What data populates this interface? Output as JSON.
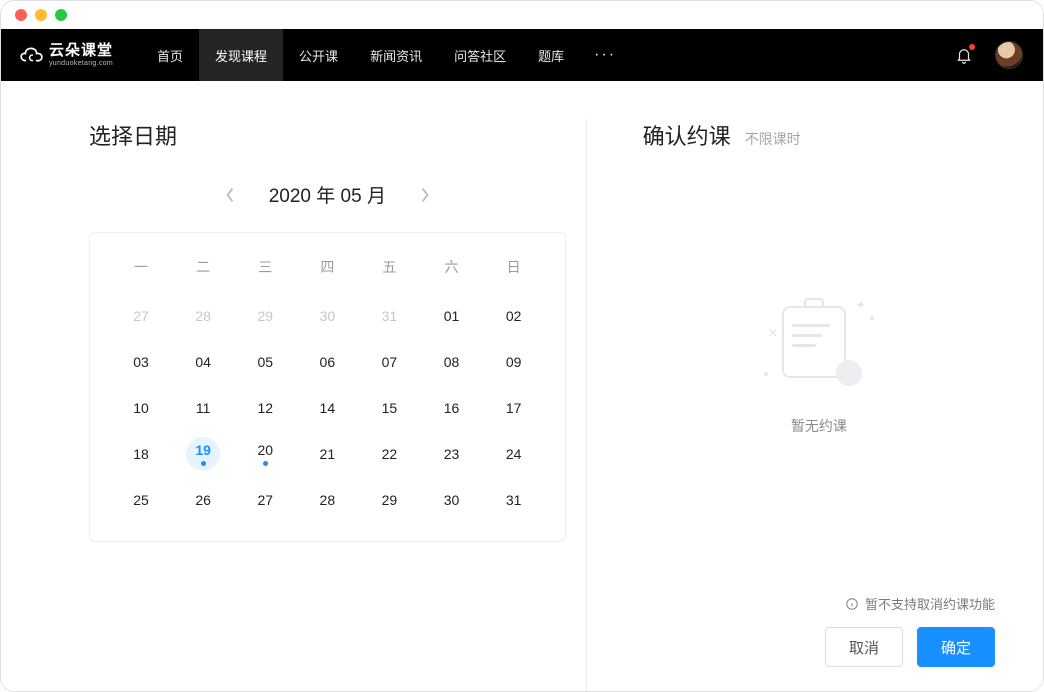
{
  "logo": {
    "name": "云朵课堂",
    "sub": "yunduoketang.com"
  },
  "nav": {
    "items": [
      {
        "label": "首页",
        "active": false
      },
      {
        "label": "发现课程",
        "active": true
      },
      {
        "label": "公开课",
        "active": false
      },
      {
        "label": "新闻资讯",
        "active": false
      },
      {
        "label": "问答社区",
        "active": false
      },
      {
        "label": "题库",
        "active": false
      }
    ]
  },
  "left": {
    "title": "选择日期",
    "calendar": {
      "header": "2020 年 05 月",
      "weekdays": [
        "一",
        "二",
        "三",
        "四",
        "五",
        "六",
        "日"
      ],
      "cells": [
        {
          "d": "27",
          "out": true
        },
        {
          "d": "28",
          "out": true
        },
        {
          "d": "29",
          "out": true
        },
        {
          "d": "30",
          "out": true
        },
        {
          "d": "31",
          "out": true
        },
        {
          "d": "01"
        },
        {
          "d": "02"
        },
        {
          "d": "03"
        },
        {
          "d": "04"
        },
        {
          "d": "05"
        },
        {
          "d": "06"
        },
        {
          "d": "07"
        },
        {
          "d": "08"
        },
        {
          "d": "09"
        },
        {
          "d": "10"
        },
        {
          "d": "11"
        },
        {
          "d": "12"
        },
        {
          "d": "14"
        },
        {
          "d": "15"
        },
        {
          "d": "16"
        },
        {
          "d": "17"
        },
        {
          "d": "18"
        },
        {
          "d": "19",
          "today": true,
          "dot": true
        },
        {
          "d": "20",
          "dot": true
        },
        {
          "d": "21"
        },
        {
          "d": "22"
        },
        {
          "d": "23"
        },
        {
          "d": "24"
        },
        {
          "d": "25"
        },
        {
          "d": "26"
        },
        {
          "d": "27"
        },
        {
          "d": "28"
        },
        {
          "d": "29"
        },
        {
          "d": "30"
        },
        {
          "d": "31"
        }
      ]
    }
  },
  "right": {
    "title": "确认约课",
    "subtitle": "不限课时",
    "empty_text": "暂无约课",
    "footer_note": "暂不支持取消约课功能",
    "cancel_label": "取消",
    "confirm_label": "确定"
  }
}
